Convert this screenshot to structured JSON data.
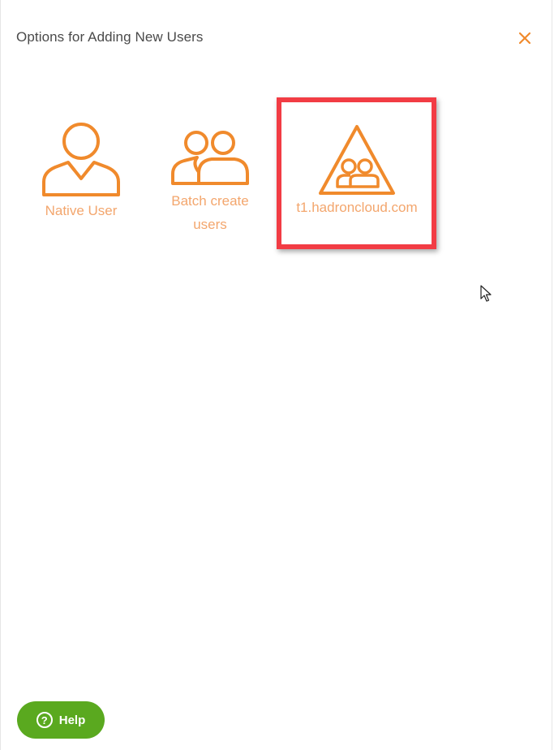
{
  "dialog": {
    "title": "Options for Adding New Users"
  },
  "options": [
    {
      "label": "Native User",
      "icon": "user-icon"
    },
    {
      "label_line1": "Batch create",
      "label_line2": "users",
      "icon": "users-group-icon"
    },
    {
      "label": "t1.hadroncloud.com",
      "icon": "domain-users-triangle-icon"
    }
  ],
  "help": {
    "label": "Help",
    "icon_glyph": "?"
  },
  "colors": {
    "accent": "#f08a2c",
    "label": "#f3a66d",
    "highlight": "#f23c44",
    "help_bg": "#5aa91f"
  }
}
